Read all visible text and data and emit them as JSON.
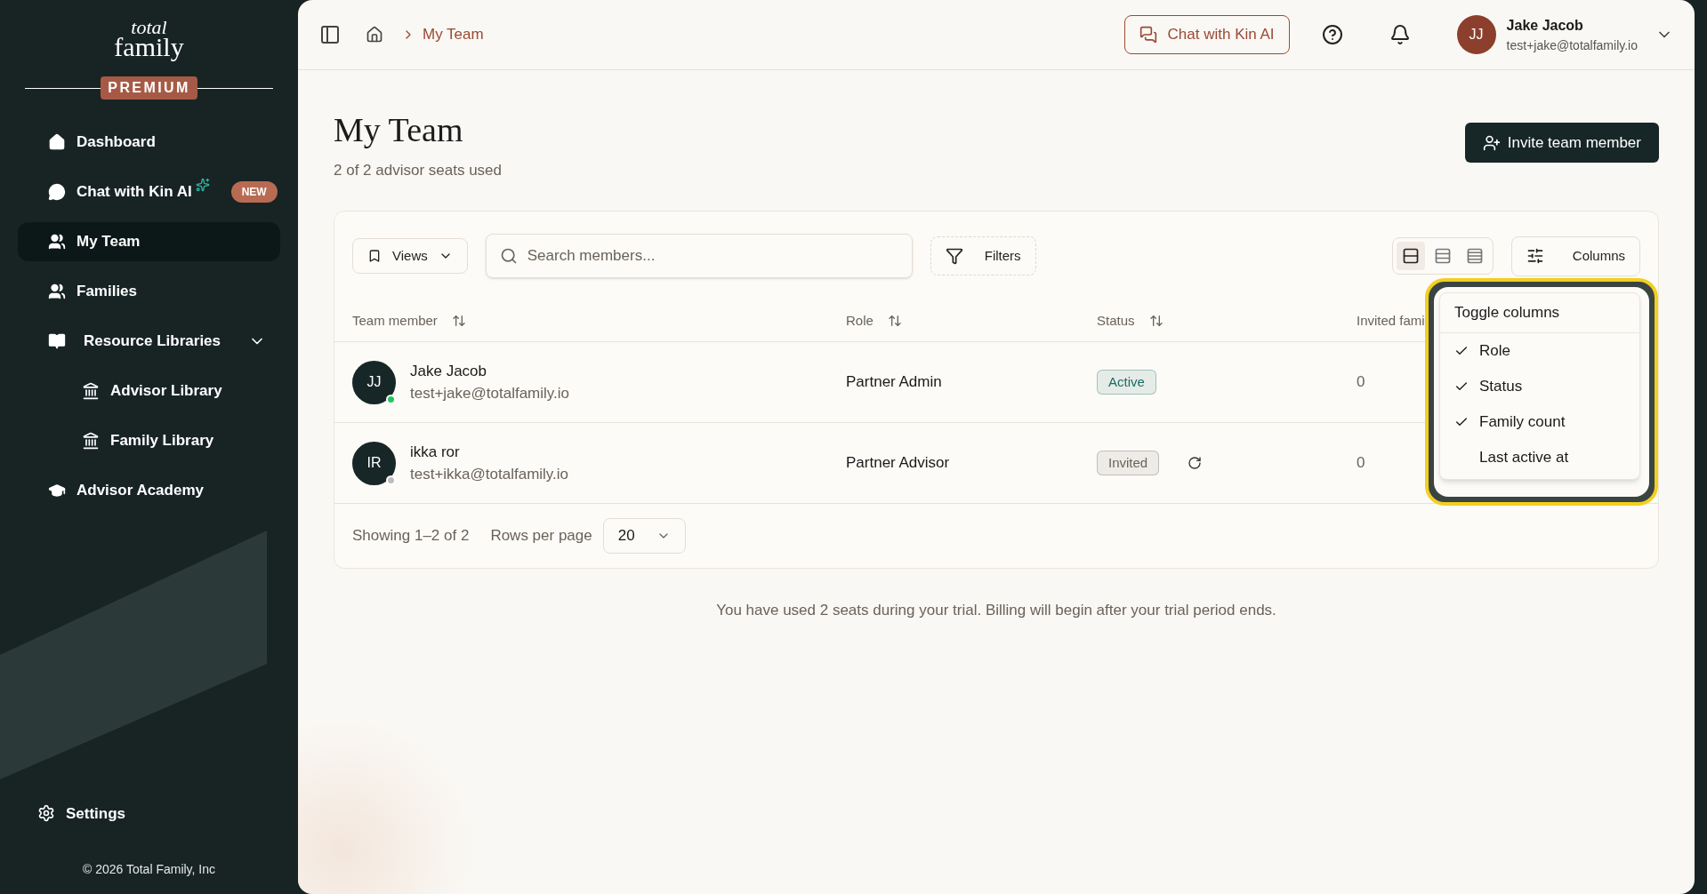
{
  "sidebar": {
    "logo": {
      "line_1": "total",
      "line_2": "family"
    },
    "plan_badge": "PREMIUM",
    "items": [
      {
        "label": "Dashboard",
        "selected": false
      },
      {
        "label": "Chat with Kin AI",
        "selected": false,
        "sparkle": true,
        "badge": "NEW"
      },
      {
        "label": "My Team",
        "selected": true
      },
      {
        "label": "Families",
        "selected": false
      },
      {
        "label": "Resource Libraries",
        "selected": false,
        "expanded": true,
        "children": [
          {
            "label": "Advisor Library",
            "selected": false
          },
          {
            "label": "Family Library",
            "selected": false
          }
        ]
      },
      {
        "label": "Advisor Academy",
        "selected": false
      }
    ],
    "settings": "Settings",
    "footer": "© 2026 Total Family, Inc"
  },
  "header": {
    "breadcrumb": "My Team",
    "chat_button": "Chat with Kin AI",
    "user": {
      "initials": "JJ",
      "name": "Jake Jacob",
      "email": "test+jake@totalfamily.io"
    }
  },
  "page": {
    "title": "My Team",
    "subtitle": "2 of 2 advisor seats used",
    "invite_button": "Invite team member"
  },
  "toolbar": {
    "views": "Views",
    "search_placeholder": "Search members...",
    "filters": "Filters",
    "densities": [
      {
        "selected": true
      },
      {
        "selected": false
      },
      {
        "selected": false
      }
    ],
    "columns": "Columns"
  },
  "table": {
    "columns": [
      "Team member",
      "Role",
      "Status",
      "Invited fami"
    ],
    "rows": [
      {
        "initials": "JJ",
        "name": "Jake Jacob",
        "email": "test+jake@totalfamily.io",
        "online": true,
        "role": "Partner Admin",
        "status": "Active",
        "color": "#1c6b63",
        "resend": false,
        "families": "0"
      },
      {
        "initials": "IR",
        "name": "ikka ror",
        "email": "test+ikka@totalfamily.io",
        "online": false,
        "role": "Partner Advisor",
        "status": "Invited",
        "color": "#6b6259",
        "resend": true,
        "families": "0"
      }
    ],
    "showing": "Showing 1–2 of 2",
    "rows_per_page_label": "Rows per page",
    "rows_per_page": "20"
  },
  "column_menu": {
    "title": "Toggle columns",
    "items": [
      {
        "label": "Role",
        "checked": true
      },
      {
        "label": "Status",
        "checked": true
      },
      {
        "label": "Family count",
        "checked": true
      },
      {
        "label": "Last active at",
        "checked": false
      }
    ]
  },
  "notice": "You have used 2 seats during your trial. Billing will begin after your trial period ends."
}
